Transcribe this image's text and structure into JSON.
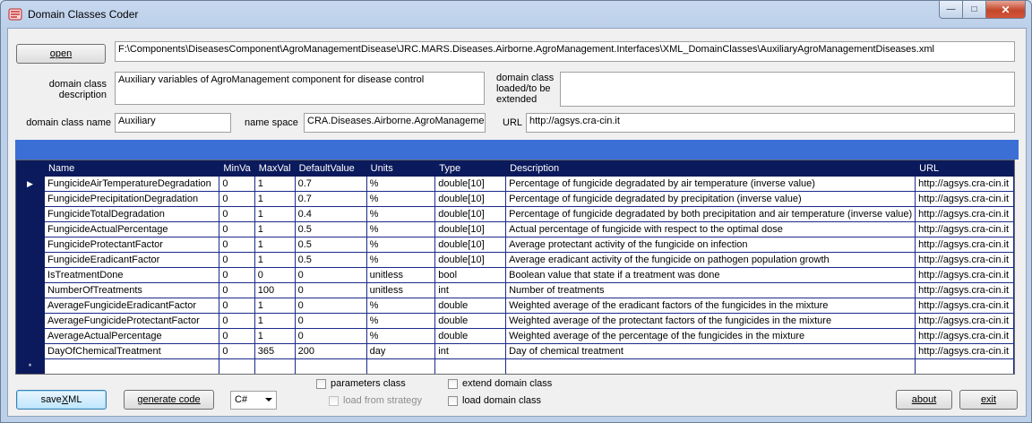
{
  "window": {
    "title": "Domain Classes Coder"
  },
  "buttons": {
    "open": "open",
    "save_xml_prefix": "save ",
    "save_xml_underlined": "X",
    "save_xml_suffix": "ML",
    "generate_code": "generate code",
    "about": "about",
    "exit": "exit"
  },
  "file": {
    "path": "F:\\Components\\DiseasesComponent\\AgroManagementDisease\\JRC.MARS.Diseases.Airborne.AgroManagement.Interfaces\\XML_DomainClasses\\AuxiliaryAgroManagementDiseases.xml"
  },
  "description": {
    "label": "domain class description",
    "value": "Auxiliary variables of AgroManagement component for disease control"
  },
  "loaded": {
    "label": "domain class loaded/to be extended",
    "value": ""
  },
  "class_name": {
    "label": "domain class name",
    "value": "Auxiliary"
  },
  "namespace": {
    "label": "name space",
    "value": "CRA.Diseases.Airborne.AgroManagement"
  },
  "url": {
    "label": "URL",
    "value": "http://agsys.cra-cin.it"
  },
  "grid": {
    "columns": [
      "Name",
      "MinVa",
      "MaxVal",
      "DefaultValue",
      "Units",
      "Type",
      "Description",
      "URL"
    ],
    "rows": [
      [
        "FungicideAirTemperatureDegradation",
        "0",
        "1",
        "0.7",
        "%",
        "double[10]",
        "Percentage of fungicide degradated by air temperature (inverse value)",
        "http://agsys.cra-cin.it"
      ],
      [
        "FungicidePrecipitationDegradation",
        "0",
        "1",
        "0.7",
        "%",
        "double[10]",
        "Percentage of fungicide degradated by precipitation (inverse value)",
        "http://agsys.cra-cin.it"
      ],
      [
        "FungicideTotalDegradation",
        "0",
        "1",
        "0.4",
        "%",
        "double[10]",
        "Percentage of fungicide degradated by both precipitation and air temperature (inverse value)",
        "http://agsys.cra-cin.it"
      ],
      [
        "FungicideActualPercentage",
        "0",
        "1",
        "0.5",
        "%",
        "double[10]",
        "Actual percentage of fungicide with respect to the optimal dose",
        "http://agsys.cra-cin.it"
      ],
      [
        "FungicideProtectantFactor",
        "0",
        "1",
        "0.5",
        "%",
        "double[10]",
        "Average protectant activity of the fungicide on infection",
        "http://agsys.cra-cin.it"
      ],
      [
        "FungicideEradicantFactor",
        "0",
        "1",
        "0.5",
        "%",
        "double[10]",
        "Average eradicant activity of the fungicide on pathogen population growth",
        "http://agsys.cra-cin.it"
      ],
      [
        "IsTreatmentDone",
        "0",
        "0",
        "0",
        "unitless",
        "bool",
        "Boolean value that state if a treatment was done",
        "http://agsys.cra-cin.it"
      ],
      [
        "NumberOfTreatments",
        "0",
        "100",
        "0",
        "unitless",
        "int",
        "Number of treatments",
        "http://agsys.cra-cin.it"
      ],
      [
        "AverageFungicideEradicantFactor",
        "0",
        "1",
        "0",
        "%",
        "double",
        "Weighted average of the eradicant factors of the fungicides in the mixture",
        "http://agsys.cra-cin.it"
      ],
      [
        "AverageFungicideProtectantFactor",
        "0",
        "1",
        "0",
        "%",
        "double",
        "Weighted average of the protectant factors of the fungicides in the mixture",
        "http://agsys.cra-cin.it"
      ],
      [
        "AverageActualPercentage",
        "0",
        "1",
        "0",
        "%",
        "double",
        "Weighted average of the percentage of the fungicides in the mixture",
        "http://agsys.cra-cin.it"
      ],
      [
        "DayOfChemicalTreatment",
        "0",
        "365",
        "200",
        "day",
        "int",
        "Day of chemical treatment",
        "http://agsys.cra-cin.it"
      ]
    ],
    "current_row_marker": "▶",
    "new_row_marker": "*"
  },
  "options": {
    "parameters_class": "parameters class",
    "load_from_strategy": "load from strategy",
    "extend_domain_class": "extend domain class",
    "load_domain_class": "load domain class"
  },
  "language": {
    "selected": "C#"
  },
  "colors": {
    "header": "#0b1a5c",
    "blue_bar": "#3b6fd6",
    "grid_lines": "#1a2a8a"
  }
}
